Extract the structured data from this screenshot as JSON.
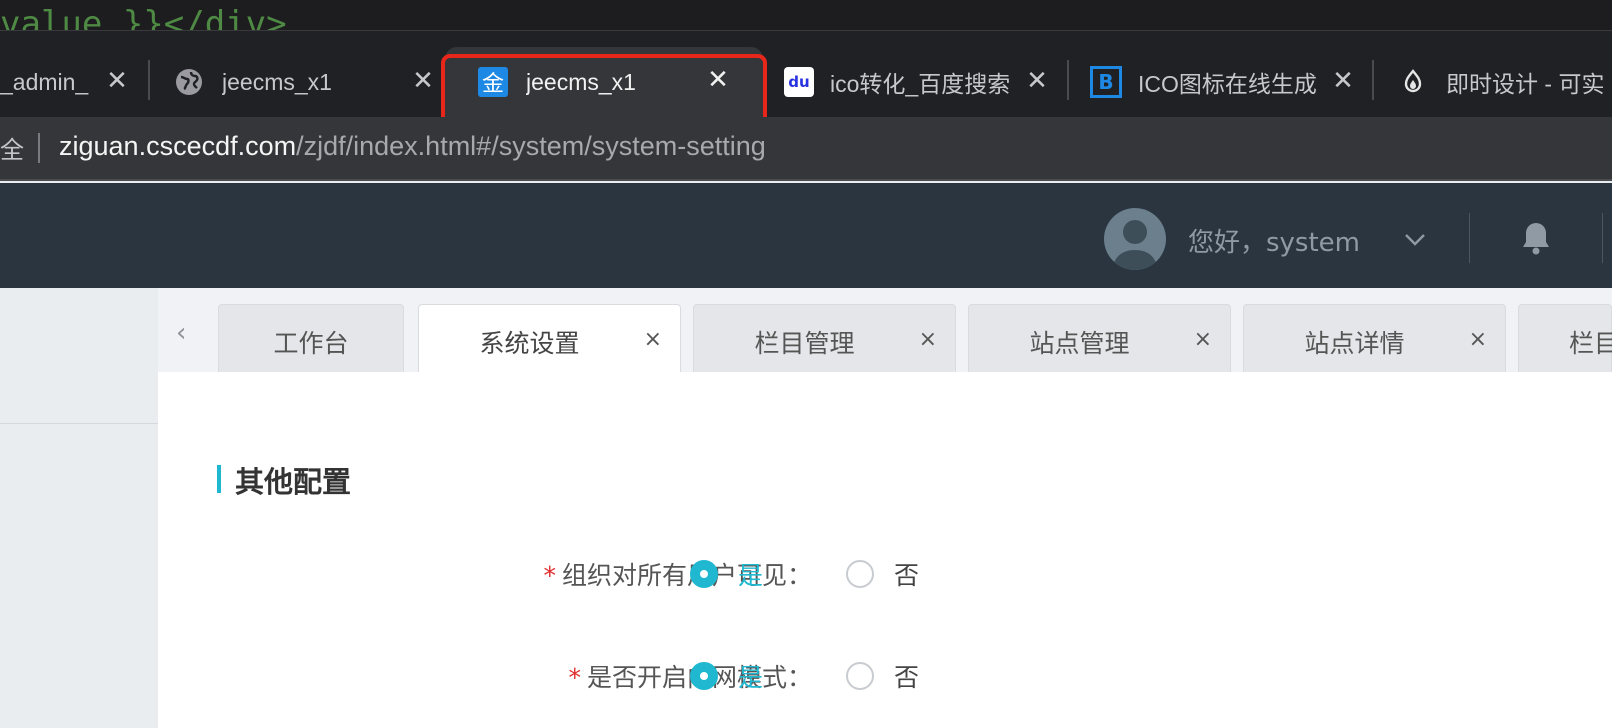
{
  "code_strip": {
    "text": "value }}</div>"
  },
  "browser": {
    "tabs": [
      {
        "title": "_admin_",
        "icon": "none"
      },
      {
        "title": "jeecms_x1",
        "icon": "globe-icon"
      },
      {
        "title": "jeecms_x1",
        "icon": "jin-favicon",
        "favicon_text": "金",
        "active": true
      },
      {
        "title": "ico转化_百度搜索",
        "icon": "baidu-icon",
        "favicon_text": "du"
      },
      {
        "title": "ICO图标在线生成",
        "icon": "bitbug-icon",
        "favicon_text": "B"
      },
      {
        "title": "即时设计 - 可实",
        "icon": "flame-icon"
      }
    ],
    "close_glyph": "✕",
    "address": {
      "secure_text": "全",
      "host": "ziguan.cscecdf.com",
      "path": "/zjdf/index.html#/system/system-setting"
    }
  },
  "header": {
    "greeting": "您好，system",
    "accent": "#2a3540"
  },
  "page_tabs": {
    "prev_glyph": "‹",
    "close_glyph": "×",
    "items": [
      {
        "label": "工作台",
        "closable": false
      },
      {
        "label": "系统设置",
        "closable": true,
        "active": true
      },
      {
        "label": "栏目管理",
        "closable": true
      },
      {
        "label": "站点管理",
        "closable": true
      },
      {
        "label": "站点详情",
        "closable": true
      },
      {
        "label": "栏目",
        "closable": false
      }
    ]
  },
  "content": {
    "section_title": "其他配置",
    "accent": "#1fb8d0",
    "rows": [
      {
        "required": "*",
        "label": "组织对所有用户可见：",
        "yes": "是",
        "no": "否",
        "selected": "yes"
      },
      {
        "required": "*",
        "label": "是否开启内网模式：",
        "yes": "是",
        "no": "否",
        "selected": "yes"
      }
    ]
  }
}
